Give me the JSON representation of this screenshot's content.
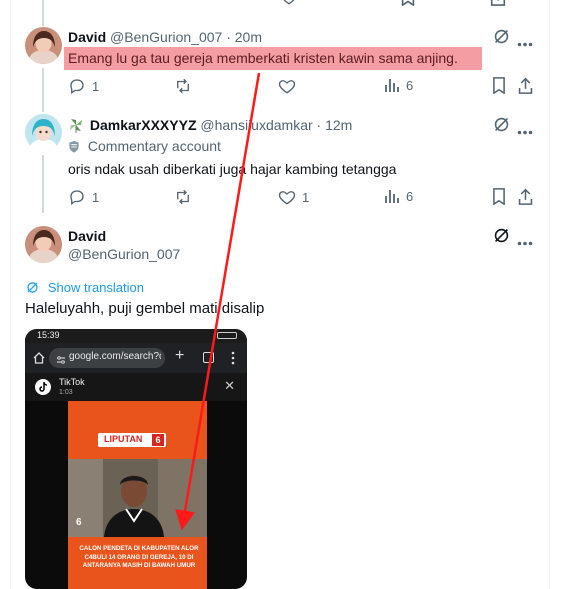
{
  "colors": {
    "accent": "#1d9bf0",
    "muted": "#536471",
    "highlight": "#f49ea4",
    "arrow": "#ff1a1a"
  },
  "tweets": [
    {
      "name": "David",
      "handle": "@BenGurion_007",
      "dot": "·",
      "time": "20m",
      "text": "Emang lu ga tau gereja memberkati kristen kawin sama anjing.",
      "replies": "1",
      "views": "6"
    },
    {
      "name": "DamkarXXXYYZ",
      "handle": "@hansiiuxdamkar",
      "dot": "·",
      "time": "12m",
      "badge": "Commentary account",
      "text": "oris ndak usah diberkati juga hajar kambing tetangga",
      "replies": "1",
      "likes": "1",
      "views": "6"
    }
  ],
  "main_tweet": {
    "name": "David",
    "handle": "@BenGurion_007",
    "show_translation": "Show translation",
    "text": "Haleluyahh, puji gembel mati disalip"
  },
  "media": {
    "status_time": "15:39",
    "url": "google.com/search?q=",
    "tiktok_label": "TikTok",
    "tiktok_time": "1:03",
    "news_badge": "LIPUTAN",
    "news_badge_num": "6",
    "channel_num": "6",
    "caption": "CALON PENDETA DI KABUPATEN ALOR C4BULI 14 ORANG DI GEREJA, 10 DI ANTARANYA MASIH DI BAWAH UMUR"
  },
  "icons": [
    "reply-icon",
    "retweet-icon",
    "like-icon",
    "views-icon",
    "bookmark-icon",
    "share-icon",
    "grok-icon",
    "more-icon",
    "translate-icon",
    "home-icon",
    "tune-icon",
    "plus-icon",
    "tabs-icon",
    "close-icon",
    "tiktok-icon"
  ]
}
